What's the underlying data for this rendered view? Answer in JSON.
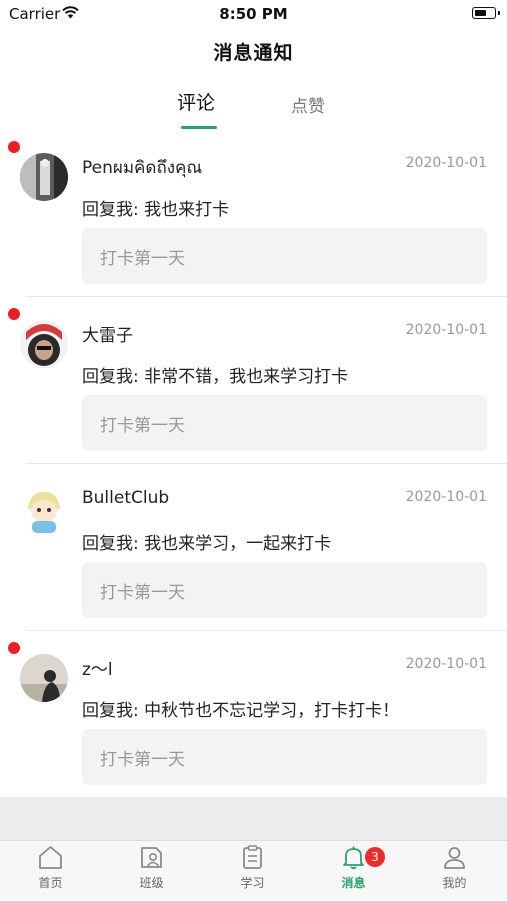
{
  "status_bar": {
    "carrier": "Carrier",
    "time": "8:50 PM"
  },
  "header": {
    "title": "消息通知"
  },
  "tabs": [
    {
      "label": "评论",
      "active": true
    },
    {
      "label": "点赞",
      "active": false
    }
  ],
  "notifications": [
    {
      "username": "Penผมคิดถึงคุณ",
      "date": "2020-10-01",
      "reply": "回复我: 我也来打卡",
      "quote": "打卡第一天",
      "unread": true
    },
    {
      "username": "大雷子",
      "date": "2020-10-01",
      "reply": "回复我: 非常不错，我也来学习打卡",
      "quote": "打卡第一天",
      "unread": true
    },
    {
      "username": "BulletClub",
      "date": "2020-10-01",
      "reply": "回复我: 我也来学习，一起来打卡",
      "quote": "打卡第一天",
      "unread": false
    },
    {
      "username": "z～l",
      "date": "2020-10-01",
      "reply": "回复我: 中秋节也不忘记学习，打卡打卡！",
      "quote": "打卡第一天",
      "unread": true
    }
  ],
  "tabbar": {
    "items": [
      {
        "label": "首页",
        "icon": "home-icon"
      },
      {
        "label": "班级",
        "icon": "class-icon"
      },
      {
        "label": "学习",
        "icon": "clipboard-icon"
      },
      {
        "label": "消息",
        "icon": "bell-icon",
        "badge": "3",
        "active": true
      },
      {
        "label": "我的",
        "icon": "person-icon"
      }
    ]
  },
  "colors": {
    "accent": "#27a36a",
    "unread_dot": "#ee1c25",
    "badge": "#ee2b2b"
  }
}
